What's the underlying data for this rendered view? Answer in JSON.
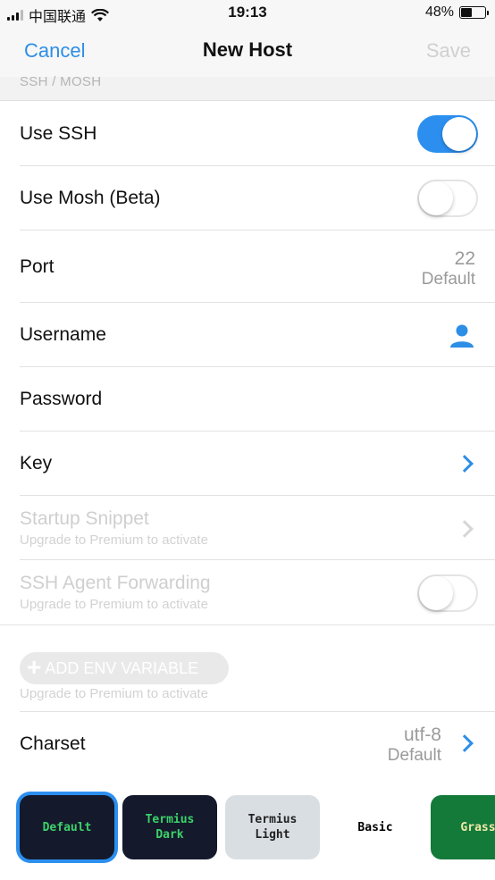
{
  "status_bar": {
    "carrier": "中国联通",
    "time": "19:13",
    "battery_percent": "48%",
    "battery_level": 0.48
  },
  "nav": {
    "cancel_label": "Cancel",
    "title": "New Host",
    "save_label": "Save"
  },
  "section": {
    "header": "SSH / MOSH"
  },
  "rows": {
    "use_ssh": {
      "label": "Use SSH",
      "on": true
    },
    "use_mosh": {
      "label": "Use Mosh (Beta)",
      "on": false
    },
    "port": {
      "label": "Port",
      "value": "22",
      "caption": "Default"
    },
    "username": {
      "label": "Username",
      "icon": "person-icon"
    },
    "password": {
      "label": "Password"
    },
    "key": {
      "label": "Key",
      "icon": "chevron-right-icon"
    },
    "startup_snippet": {
      "label": "Startup Snippet",
      "subtitle": "Upgrade to Premium to activate"
    },
    "agent_forwarding": {
      "label": "SSH Agent Forwarding",
      "subtitle": "Upgrade to Premium to activate",
      "on": false
    },
    "env": {
      "button_label": "ADD ENV VARIABLE",
      "subtitle": "Upgrade to Premium to activate"
    },
    "charset": {
      "label": "Charset",
      "value": "utf-8",
      "caption": "Default"
    }
  },
  "themes": [
    {
      "name": "Default",
      "bg": "#141a2c",
      "fg": "#3dd16a",
      "selected": true
    },
    {
      "name": "Termius\nDark",
      "bg": "#141a2c",
      "fg": "#3dd16a",
      "selected": false
    },
    {
      "name": "Termius\nLight",
      "bg": "#d9dee2",
      "fg": "#222222",
      "selected": false
    },
    {
      "name": "Basic",
      "bg": "#ffffff",
      "fg": "#000000",
      "selected": false
    },
    {
      "name": "Grass",
      "bg": "#137a3a",
      "fg": "#f2e8a8",
      "selected": false
    }
  ],
  "colors": {
    "accent": "#2c8ff0",
    "disabled_text": "#cfcfcf"
  }
}
